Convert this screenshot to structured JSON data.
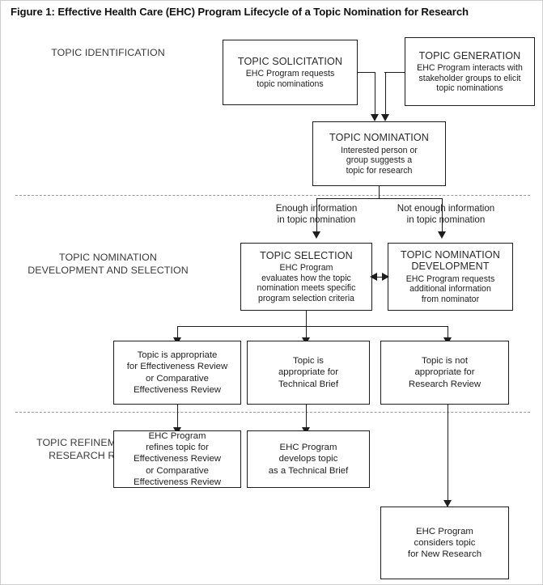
{
  "figure": {
    "title": "Figure 1: Effective Health Care (EHC) Program Lifecycle of a Topic Nomination for Research",
    "accent_color": "#1d1d1d",
    "divider_color": "#9a9a9a",
    "background_color": "#ffffff"
  },
  "stages": [
    {
      "id": "identification",
      "label": "TOPIC\nIDENTIFICATION"
    },
    {
      "id": "nomination-development-selection",
      "label": "TOPIC\nNOMINATION\nDEVELOPMENT\nAND SELECTION"
    },
    {
      "id": "refinement",
      "label": "TOPIC\nREFINEMENT\nFOR RESEARCH\nREVIEW"
    }
  ],
  "nodes": {
    "topic_solicitation": {
      "title": "TOPIC SOLICITATION",
      "body": "EHC Program requests\ntopic nominations"
    },
    "topic_generation": {
      "title": "TOPIC GENERATION",
      "body": "EHC Program interacts with\nstakeholder groups to elicit\ntopic nominations"
    },
    "topic_nomination": {
      "title": "TOPIC NOMINATION",
      "body": "Interested person or\ngroup suggests a\ntopic for research"
    },
    "topic_selection": {
      "title": "TOPIC SELECTION",
      "body": "EHC Program\nevaluates how the topic\nnomination meets specific\nprogram selection criteria"
    },
    "topic_nomination_development": {
      "title": "TOPIC NOMINATION\nDEVELOPMENT",
      "body": "EHC Program requests\nadditional information\nfrom nominator"
    },
    "outcome_effectiveness": {
      "body": "Topic is appropriate\nfor Effectiveness Review\nor Comparative\nEffectiveness Review"
    },
    "outcome_technical_brief": {
      "body": "Topic is\nappropriate for\nTechnical Brief"
    },
    "outcome_not_appropriate": {
      "body": "Topic is not\nappropriate for\nResearch Review"
    },
    "refine_effectiveness": {
      "body": "EHC Program\nrefines topic for\nEffectiveness Review\nor Comparative\nEffectiveness Review"
    },
    "develop_technical_brief": {
      "body": "EHC Program\ndevelops topic\nas a Technical Brief"
    },
    "consider_new_research": {
      "body": "EHC Program\nconsiders topic\nfor New Research"
    }
  },
  "edge_labels": {
    "enough_information": "Enough information\nin topic nomination",
    "not_enough_information": "Not enough information\nin topic nomination"
  }
}
